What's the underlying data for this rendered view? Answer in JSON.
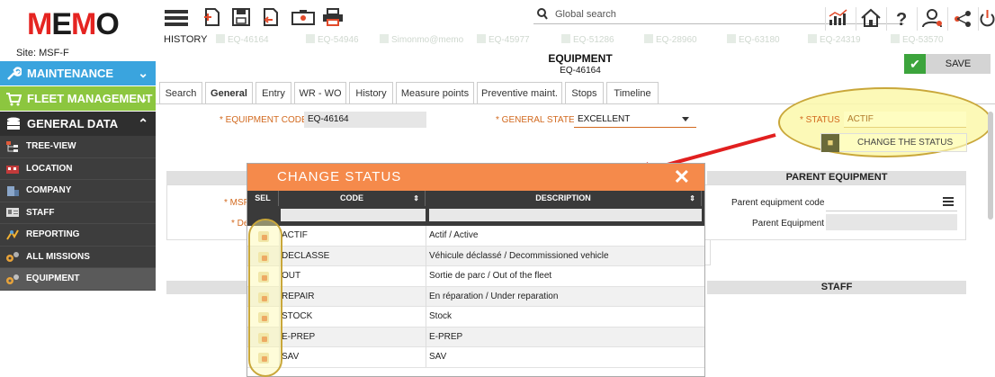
{
  "app": {
    "logo": "MEMO",
    "site": "Site: MSF-F"
  },
  "sidebar": {
    "main": [
      {
        "label": "MAINTENANCE",
        "color": "#3aa4de"
      },
      {
        "label": "FLEET MANAGEMENT",
        "color": "#8cc63f"
      },
      {
        "label": "GENERAL DATA",
        "color": "#2f2f2f"
      }
    ],
    "items": [
      {
        "label": "TREE-VIEW"
      },
      {
        "label": "LOCATION"
      },
      {
        "label": "COMPANY"
      },
      {
        "label": "STAFF"
      },
      {
        "label": "REPORTING"
      },
      {
        "label": "ALL MISSIONS"
      },
      {
        "label": "EQUIPMENT"
      }
    ]
  },
  "toolbar": {
    "search_label": "Global search"
  },
  "history": {
    "label": "HISTORY",
    "items": [
      "EQ-46164",
      "EQ-54946",
      "Simonmo@memo",
      "EQ-45977",
      "EQ-51286",
      "EQ-28960",
      "EQ-63180",
      "EQ-24319",
      "EQ-53570"
    ]
  },
  "page": {
    "title": "EQUIPMENT",
    "code": "EQ-46164",
    "save_label": "SAVE"
  },
  "tabs": [
    "Search",
    "General",
    "Entry",
    "WR - WO",
    "History",
    "Measure points",
    "Preventive maint.",
    "Stops",
    "Timeline"
  ],
  "form": {
    "equipment_code_label": "* EQUIPMENT CODE",
    "equipment_code_value": "EQ-46164",
    "general_state_label": "* GENERAL STATE",
    "general_state_value": "EXCELLENT",
    "status_label": "* STATUS",
    "status_value": "ACTIF",
    "change_status_label": "CHANGE THE STATUS",
    "msf_label": "* MSF",
    "de_label": "* De",
    "parent_section": "PARENT EQUIPMENT",
    "parent_code_label": "Parent equipment code",
    "parent_equipment_label": "Parent Equipment",
    "staff_section": "STAFF"
  },
  "modal": {
    "title": "CHANGE STATUS",
    "columns": {
      "sel": "SEL",
      "code": "CODE",
      "description": "DESCRIPTION"
    },
    "rows": [
      {
        "code": "ACTIF",
        "description": "Actif / Active"
      },
      {
        "code": "DECLASSE",
        "description": "Véhicule déclassé / Decommissioned vehicle"
      },
      {
        "code": "OUT",
        "description": "Sortie de parc / Out of the fleet"
      },
      {
        "code": "REPAIR",
        "description": "En réparation / Under reparation"
      },
      {
        "code": "STOCK",
        "description": "Stock"
      },
      {
        "code": "E-PREP",
        "description": "E-PREP"
      },
      {
        "code": "SAV",
        "description": "SAV"
      }
    ]
  },
  "colors": {
    "accent": "#f58a4b",
    "annotation": "#c9a73a",
    "arrow": "#e11f1f",
    "save_check": "#3ca43c"
  }
}
